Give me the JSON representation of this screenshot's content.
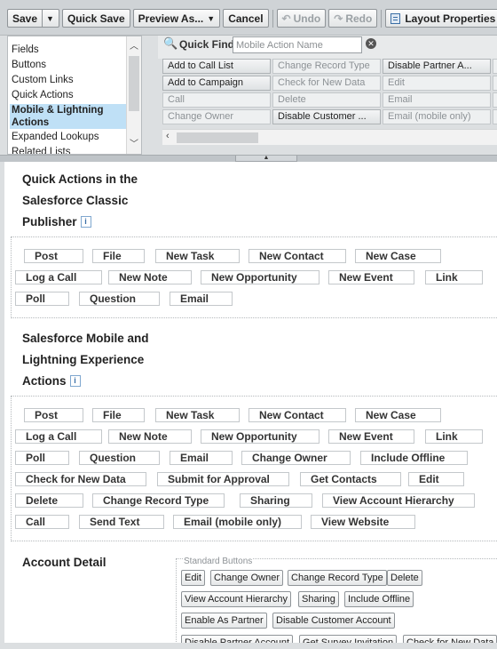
{
  "toolbar": {
    "save": "Save",
    "quick_save": "Quick Save",
    "preview_as": "Preview As...",
    "cancel": "Cancel",
    "undo": "Undo",
    "redo": "Redo",
    "layout_properties": "Layout Properties"
  },
  "palette": {
    "categories": [
      "Fields",
      "Buttons",
      "Custom Links",
      "Quick Actions",
      "Mobile & Lightning Actions",
      "Expanded Lookups",
      "Related Lists"
    ],
    "selected_category": "Mobile & Lightning Actions",
    "quick_find_label": "Quick Find",
    "quick_find_placeholder": "Mobile Action Name",
    "items": [
      {
        "label": "Add to Call List",
        "available": true
      },
      {
        "label": "Change Record Type",
        "available": false
      },
      {
        "label": "Disable Partner A...",
        "available": true
      },
      {
        "label": "Add to Campaign",
        "available": true
      },
      {
        "label": "Check for New Data",
        "available": false
      },
      {
        "label": "Edit",
        "available": false
      },
      {
        "label": "Call",
        "available": false
      },
      {
        "label": "Delete",
        "available": false
      },
      {
        "label": "Email",
        "available": false
      },
      {
        "label": "Change Owner",
        "available": false
      },
      {
        "label": "Disable Customer ...",
        "available": true
      },
      {
        "label": "Email (mobile only)",
        "available": false
      }
    ]
  },
  "classic_publisher": {
    "title_lines": [
      "Quick Actions in the",
      "Salesforce Classic",
      "Publisher"
    ],
    "info": "i",
    "actions": [
      "Post",
      "File",
      "New Task",
      "New Contact",
      "New Case",
      "Log a Call",
      "New Note",
      "New Opportunity",
      "New Event",
      "Link",
      "Poll",
      "Question",
      "Email"
    ]
  },
  "lightning_actions": {
    "title_lines": [
      "Salesforce Mobile and",
      "Lightning Experience",
      "Actions"
    ],
    "info": "i",
    "actions": [
      "Post",
      "File",
      "New Task",
      "New Contact",
      "New Case",
      "Log a Call",
      "New Note",
      "New Opportunity",
      "New Event",
      "Link",
      "Poll",
      "Question",
      "Email",
      "Change Owner",
      "Include Offline",
      "Check for New Data",
      "Submit for Approval",
      "Get Contacts",
      "Edit",
      "Delete",
      "Change Record Type",
      "Sharing",
      "View Account Hierarchy",
      "Call",
      "Send Text",
      "Email (mobile only)",
      "View Website"
    ]
  },
  "account_detail": {
    "title": "Account Detail",
    "standard_buttons_label": "Standard Buttons",
    "buttons": [
      "Edit",
      "Change Owner",
      "Change Record Type",
      "Delete",
      "View Account Hierarchy",
      "Sharing",
      "Include Offline",
      "Enable As Partner",
      "Disable Customer Account",
      "Disable Partner Account",
      "Get Survey Invitation",
      "Check for New Data"
    ]
  },
  "colors": {
    "selected_category_bg": "#bfe0f6",
    "chrome_bg": "#cfd3d6",
    "link_blue": "#3a6ea5"
  }
}
